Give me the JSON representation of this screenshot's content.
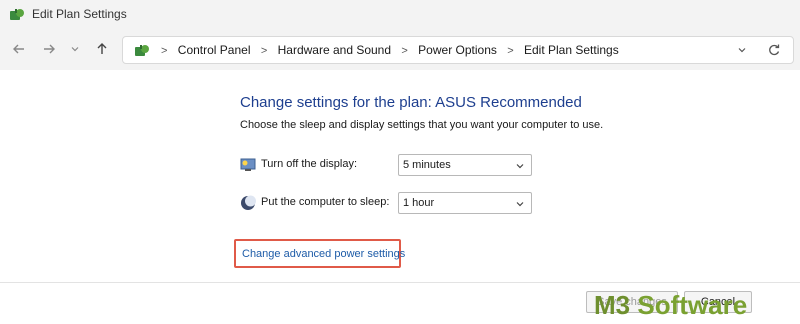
{
  "window": {
    "title": "Edit Plan Settings",
    "icon": "power-plan-icon"
  },
  "nav": {
    "back_icon": "back-arrow-icon",
    "forward_icon": "forward-arrow-icon",
    "recent_icon": "chevron-down-icon",
    "up_icon": "up-arrow-icon"
  },
  "address_bar": {
    "crumbs": [
      "Control Panel",
      "Hardware and Sound",
      "Power Options",
      "Edit Plan Settings"
    ],
    "separator": ">",
    "dropdown_icon": "chevron-down-icon",
    "refresh_icon": "refresh-icon"
  },
  "main": {
    "heading": "Change settings for the plan: ASUS Recommended",
    "subheading": "Choose the sleep and display settings that you want your computer to use.",
    "settings": [
      {
        "label": "Turn off the display:",
        "value": "5 minutes",
        "icon": "monitor-icon"
      },
      {
        "label": "Put the computer to sleep:",
        "value": "1 hour",
        "icon": "moon-icon"
      }
    ],
    "advanced_link": "Change advanced power settings"
  },
  "buttons": {
    "save": "Save changes",
    "cancel": "Cancel"
  },
  "watermark": {
    "m3": "M3",
    "software": " Software"
  },
  "colors": {
    "heading": "#1e3f8f",
    "link": "#1e5ca8",
    "highlight_border": "#e05a48",
    "watermark": "#7aa131"
  }
}
